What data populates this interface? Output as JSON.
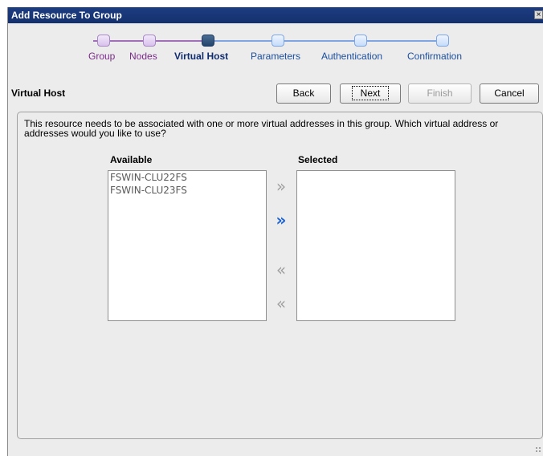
{
  "window": {
    "title": "Add Resource To Group",
    "close_glyph": "×"
  },
  "steps": [
    {
      "label": "Group",
      "state": "done"
    },
    {
      "label": "Nodes",
      "state": "done"
    },
    {
      "label": "Virtual Host",
      "state": "active"
    },
    {
      "label": "Parameters",
      "state": "pending"
    },
    {
      "label": "Authentication",
      "state": "pending"
    },
    {
      "label": "Confirmation",
      "state": "pending"
    }
  ],
  "page": {
    "heading": "Virtual Host"
  },
  "buttons": {
    "back": "Back",
    "next": "Next",
    "finish": "Finish",
    "cancel": "Cancel"
  },
  "description": "This resource needs to be associated with one or more virtual addresses in this group.  Which virtual address or addresses would you like to use?",
  "available": {
    "title": "Available",
    "items": [
      "FSWIN-CLU22FS",
      "FSWIN-CLU23FS"
    ]
  },
  "selected": {
    "title": "Selected",
    "items": []
  },
  "arrows": {
    "move_right": "»",
    "move_all_right": "»",
    "move_left": "«",
    "move_all_left": "«"
  },
  "colors": {
    "title_bar": "#14306e",
    "step_done": "#7b2a8a",
    "step_active": "#0f2c6e",
    "step_pending": "#1b4fa0",
    "arrow_enabled": "#1a62d4"
  }
}
